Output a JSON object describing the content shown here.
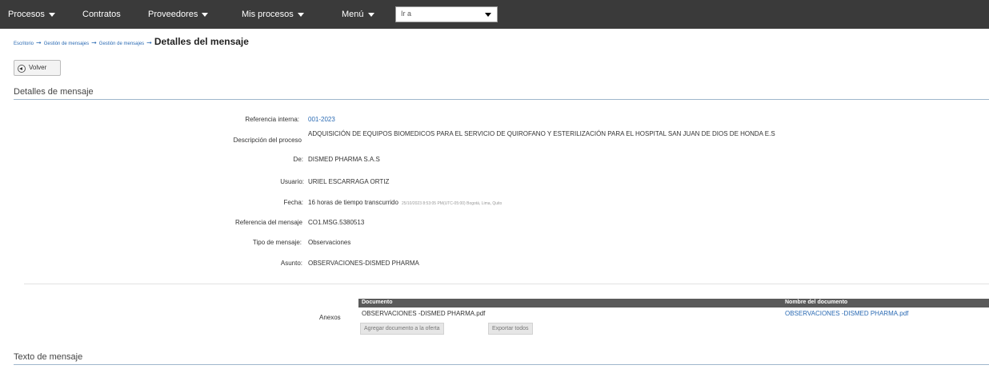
{
  "nav": {
    "items": [
      {
        "label": "Procesos",
        "has_caret": true
      },
      {
        "label": "Contratos",
        "has_caret": false
      },
      {
        "label": "Proveedores",
        "has_caret": true
      },
      {
        "label": "Mis procesos",
        "has_caret": true
      },
      {
        "label": "Menú",
        "has_caret": true
      }
    ],
    "goto_value": "Ir a"
  },
  "breadcrumb": {
    "links": [
      "Escritorio",
      "Gestión de mensajes",
      "Gestión de mensajes"
    ],
    "separator": "➞",
    "current": "Detalles del mensaje"
  },
  "back_button": {
    "label": "Volver"
  },
  "details": {
    "section_title": "Detalles de mensaje",
    "rows": [
      {
        "label": "Referencia interna:",
        "value": "001-2023"
      },
      {
        "label": "Descripción del proceso",
        "value": "ADQUISICIÓN DE EQUIPOS BIOMEDICOS PARA EL SERVICIO DE QUIROFANO Y ESTERILIZACIÓN PARA EL HOSPITAL SAN JUAN DE DIOS DE HONDA E.S"
      },
      {
        "label": "De:",
        "value": "DISMED PHARMA S.A.S"
      },
      {
        "label": "Usuario:",
        "value": "URIEL ESCARRAGA ORTIZ"
      },
      {
        "label": "Fecha:",
        "value": "16 horas de tiempo transcurrido",
        "extra": "25/10/2023 8:53:05 PM(UTC-05:00) Bogotá, Lima, Quito"
      },
      {
        "label": "Referencia del mensaje",
        "value": "CO1.MSG.5380513"
      },
      {
        "label": "Tipo de mensaje:",
        "value": "Observaciones"
      },
      {
        "label": "Asunto:",
        "value": "OBSERVACIONES-DISMED PHARMA"
      }
    ]
  },
  "attachments": {
    "label": "Anexos",
    "headers": [
      "Documento",
      "Nombre del documento"
    ],
    "rows": [
      {
        "documento": "OBSERVACIONES -DISMED PHARMA.pdf",
        "nombre": "OBSERVACIONES -DISMED PHARMA.pdf"
      }
    ],
    "add_button": "Agregar documento a la oferta",
    "export_button": "Exportar todos"
  },
  "text_section": {
    "title": "Texto de mensaje"
  },
  "colors": {
    "topbar": "#3a3a3a",
    "link": "#2a6ab3",
    "table_header": "#5a5a5a"
  }
}
